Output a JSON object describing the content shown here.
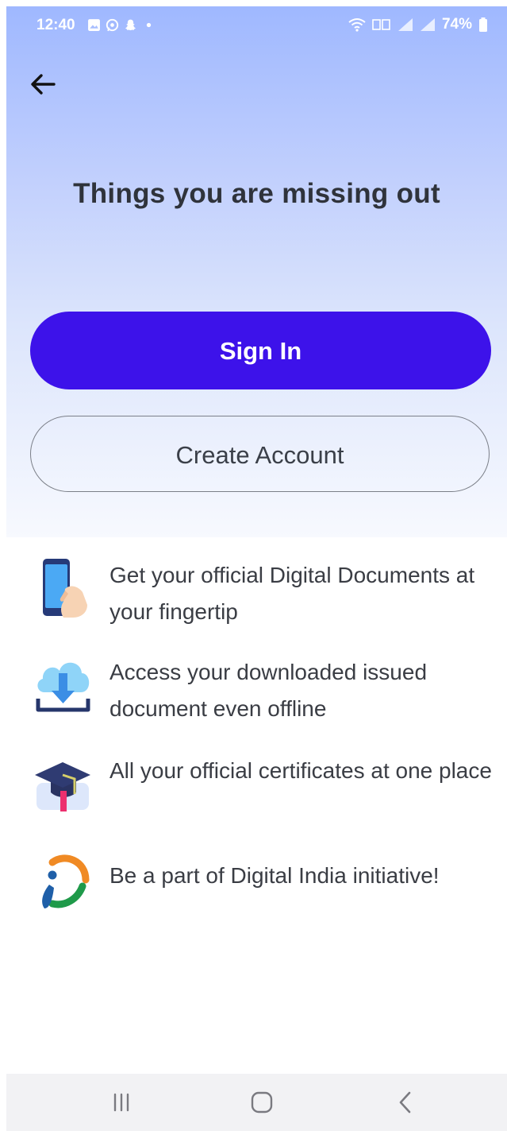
{
  "status_bar": {
    "time": "12:40",
    "battery": "74%",
    "left_icons": [
      "gallery-icon",
      "whatsapp-icon",
      "snapchat-icon",
      "dot-icon"
    ],
    "right_icons": [
      "wifi-icon",
      "volte-icon",
      "signal-icon",
      "signal-icon",
      "battery-icon"
    ]
  },
  "header": {
    "back_icon": "arrow-left-icon"
  },
  "main": {
    "title": "Things you are missing out",
    "signin_label": "Sign In",
    "create_account_label": "Create Account"
  },
  "features": [
    {
      "icon": "phone-hand-icon",
      "text": "Get your official Digital Documents at your fingertip"
    },
    {
      "icon": "cloud-download-icon",
      "text": "Access your downloaded issued document even offline"
    },
    {
      "icon": "graduation-cap-icon",
      "text": "All your official certificates at one place"
    },
    {
      "icon": "digital-india-logo-icon",
      "text": "Be a part of Digital India initiative!"
    }
  ],
  "nav_bar": {
    "recents_icon": "recents-icon",
    "home_icon": "home-icon",
    "back_icon": "back-chevron-icon"
  },
  "colors": {
    "primary": "#3d12ea",
    "title": "#2f333b",
    "hero_top": "#9fb8ff",
    "text": "#3a3d44",
    "nav_bg": "#f2f2f4"
  }
}
